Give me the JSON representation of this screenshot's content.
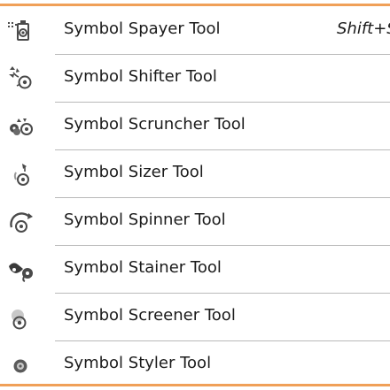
{
  "colors": {
    "accent": "#f0a058",
    "separator": "#b9b9b9",
    "text": "#1b1b1b",
    "icon": "#4a4a4a"
  },
  "menu": {
    "items": [
      {
        "label": "Symbol Spayer Tool",
        "shortcut": "Shift+S",
        "icon": "symbol-sprayer-icon"
      },
      {
        "label": "Symbol Shifter Tool",
        "icon": "symbol-shifter-icon"
      },
      {
        "label": "Symbol Scruncher Tool",
        "icon": "symbol-scruncher-icon"
      },
      {
        "label": "Symbol Sizer Tool",
        "icon": "symbol-sizer-icon"
      },
      {
        "label": "Symbol Spinner Tool",
        "icon": "symbol-spinner-icon"
      },
      {
        "label": "Symbol Stainer Tool",
        "icon": "symbol-stainer-icon"
      },
      {
        "label": "Symbol Screener Tool",
        "icon": "symbol-screener-icon"
      },
      {
        "label": "Symbol Styler Tool",
        "icon": "symbol-styler-icon"
      }
    ]
  }
}
